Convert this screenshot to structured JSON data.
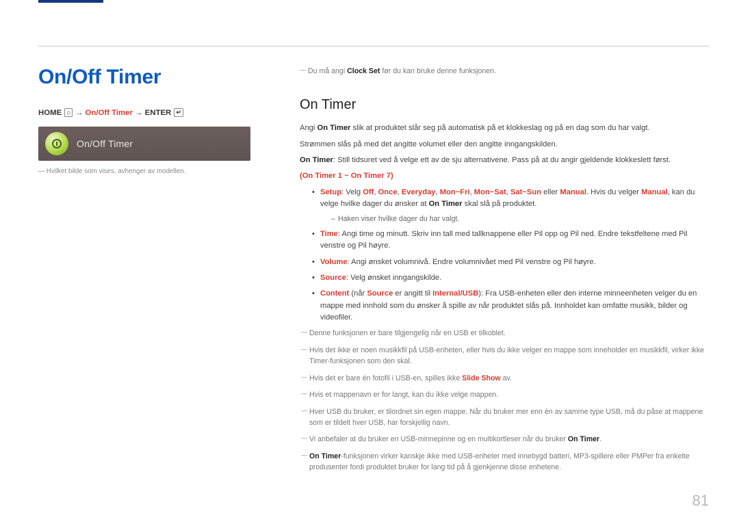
{
  "header": {
    "title": "On/Off Timer",
    "breadcrumb_prefix": "HOME",
    "breadcrumb_mid": "On/Off Timer",
    "breadcrumb_suffix": "ENTER",
    "arrow": "→",
    "home_icon": "⌂",
    "enter_icon": "↵",
    "preview_label": "On/Off Timer",
    "caption": "Hvilket bilde som vises, avhenger av modellen."
  },
  "main": {
    "topnote_before": "Du må angi ",
    "topnote_bold": "Clock Set",
    "topnote_after": " før du kan bruke denne funksjonen.",
    "subtitle": "On Timer",
    "p1_before": "Angi ",
    "p1_bold": "On Timer",
    "p1_after": " slik at produktet slår seg på automatisk på et klokkeslag og på en dag som du har valgt.",
    "p2": "Strømmen slås på med det angitte volumet eller den angitte inngangskilden.",
    "p3_before_bold": "On Timer",
    "p3_after": ": Still tidsuret ved å velge ett av de sju alternativene. Pass på at du angir gjeldende klokkeslett først.",
    "range_label": "(On Timer 1 ~ On Timer 7)",
    "bullets": {
      "setup": {
        "label": "Setup",
        "before": ": Velg ",
        "opts": [
          "Off",
          "Once",
          "Everyday",
          "Mon~Fri",
          "Mon~Sat",
          "Sat~Sun"
        ],
        "or": " eller ",
        "manual": "Manual",
        "after1": ". Hvis du velger ",
        "after2": ", kan du velge hvilke dager du ønsker at ",
        "after2_bold": "On Timer",
        "after3": " skal slå på produktet.",
        "subnote": "Haken viser hvilke dager du har valgt."
      },
      "time": {
        "label": "Time",
        "text": ": Angi time og minutt. Skriv inn tall med tallknappene eller Pil opp og Pil ned. Endre tekstfeltene med Pil venstre og Pil høyre."
      },
      "volume": {
        "label": "Volume",
        "text": ": Angi ønsket volumnivå. Endre volumnivået med Pil venstre og Pil høyre."
      },
      "source": {
        "label": "Source",
        "text": ": Velg ønsket inngangskilde."
      },
      "content": {
        "label": "Content",
        "mid1": " (når ",
        "mid_bold": "Source",
        "mid2": " er angitt til ",
        "mid_bold2": "Internal/USB",
        "mid3": "): Fra USB-enheten eller den interne minneenheten velger du en mappe med innhold som du ønsker å spille av når produktet slås på. Innholdet kan omfatte musikk, bilder og videofiler."
      }
    },
    "notes": {
      "n1": "Denne funksjonen er bare tilgjengelig når en USB er tilkoblet.",
      "n2": "Hvis det ikke er noen musikkfil på USB-enheten, eller hvis du ikke velger en mappe som inneholder en musikkfil, virker ikke Timer-funksjonen som den skal.",
      "n3_before": "Hvis det er bare én fotofil i USB-en, spilles ikke ",
      "n3_bold": "Slide Show",
      "n3_after": " av.",
      "n4": "Hvis et mappenavn er for langt, kan du ikke velge mappen.",
      "n5": "Hver USB du bruker, er tilordnet sin egen mappe. Når du bruker mer enn én av samme type USB, må du påse at mappene som er tildelt hver USB, har forskjellig navn.",
      "n6_before": "Vi anbefaler at du bruker en USB-minnepinne og en multikortleser når du bruker ",
      "n6_bold": "On Timer",
      "n6_after": ".",
      "n7_bold": "On Timer",
      "n7_text": "-funksjonen virker kanskje ikke med USB-enheter med innebygd batteri, MP3-spillere eller PMPer fra enkelte produsenter fordi produktet bruker for lang tid på å gjenkjenne disse enhetene."
    }
  },
  "pagenum": "81"
}
